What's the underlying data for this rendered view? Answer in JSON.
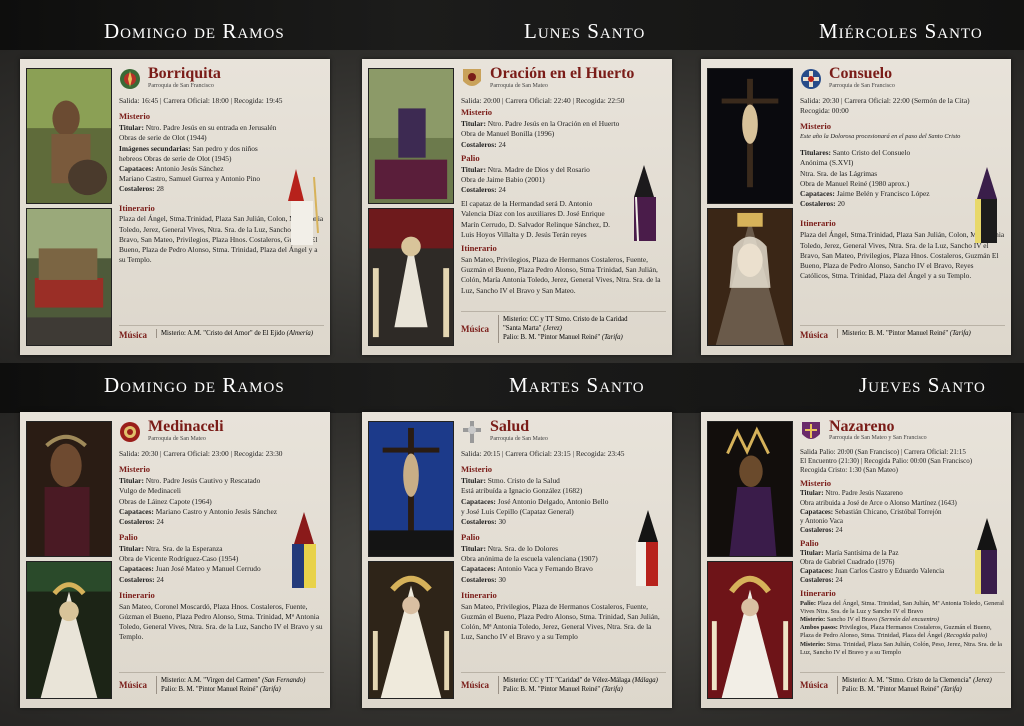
{
  "headers": {
    "h1": "Domingo de Ramos",
    "h2": "Lunes Santo",
    "h3": "Miércoles Santo",
    "h4": "Domingo de Ramos",
    "h5": "Martes Santo",
    "h6": "Jueves Santo"
  },
  "labels": {
    "misterio": "Misterio",
    "palio": "Palio",
    "itinerario": "Itinerario",
    "musica": "Música"
  },
  "c1": {
    "name": "Borriquita",
    "parish": "Parroquia de San Francisco",
    "schedule": "Salida: 16:45 | Carrera Oficial: 18:00 | Recogida: 19:45",
    "m1": "Ntro. Padre Jesús en su entrada en Jerusalén",
    "m2": "Obras de serie de Olot (1944)",
    "m3": "San pedro y dos niños",
    "m4": "hebreos Obras de serie de Olot (1945)",
    "m5": "Antonio Jesús Sánchez",
    "m6": "Mariano Castro, Samuel Gurrea y Antonio Pino",
    "m7": "28",
    "itin": "Plaza del Ángel, Stma.Trinidad, Plaza San Julián, Colon, Mª Antonia Toledo, Jerez, General Vives, Ntra. Sra. de la Luz, Sancho IV el Bravo, San Mateo, Privilegios, Plaza Hnos. Costaleros, Guzmán El Bueno, Plaza de Pedro Alonso, Stma. Trinidad, Plaza del Ángel y a su Templo.",
    "music": "Misterio: A.M. \"Cristo del Amor\" de El Ejido",
    "music_it": "(Almería)"
  },
  "c2": {
    "name": "Oración en el Huerto",
    "parish": "Parroquia de San Mateo",
    "schedule": "Salida: 20:00 | Carrera Oficial: 22:40 | Recogida: 22:50",
    "m1": "Ntro. Padre Jesús en la Oración en el Huerto",
    "m2": "Obra de Manuel Bonilla (1996)",
    "m3": "24",
    "p1": "Ntra. Madre de Dios y del Rosario",
    "p2": "Obra de Jaime Babio (2001)",
    "p3": "24",
    "capataz": "El capataz de la Hermandad será D. Antonio Valencia Díaz con los auxiliares D. José Enrique Marín Cerrudo, D. Salvador Relinque Sánchez, D. Luis Hoyos Villalta y D. Jesús Terán reyes",
    "itin": "San Mateo, Privilegios, Plaza de Hermanos Costaleros, Fuente, Guzmán el Bueno, Plaza Pedro Alonso, Stma Trinidad, San Julián, Colón, María Antonia Toledo, Jerez, General Vives, Ntra. Sra. de la Luz, Sancho IV el Bravo y San Mateo.",
    "music1": "Misterio: CC y TT Stmo. Cristo de la Caridad",
    "music2": "\"Santa Marta\"",
    "music2_it": "(Jerez)",
    "music3": "Palio: B. M. \"Pintor Manuel Reiné\"",
    "music3_it": "(Tarifa)"
  },
  "c3": {
    "name": "Consuelo",
    "parish": "Parroquia de San Francisco",
    "schedule": "Salida: 20:30 | Carrera Oficial: 22:00 (Sermón de la Cita)",
    "schedule2": "Recogida: 00:00",
    "note": "Este año la Dolorosa procesionará en el paso del Santo Cristo",
    "m1": "Santo Cristo del Consuelo",
    "m2": "Anónima (S.XVI)",
    "m3": "Ntra. Sra. de las Lágrimas",
    "m4": "Obra de Manuel Reiné (1980 aprox.)",
    "m5": "Jaime Belén y Francisco López",
    "m6": "20",
    "itin": "Plaza del Ángel, Stma.Trinidad, Plaza San Julián, Colon, Mª Antonia Toledo, Jerez, General Vives, Ntra. Sra. de la Luz, Sancho IV el Bravo, San Mateo, Privilegios, Plaza Hnos. Costaleros, Guzmán El Bueno, Plaza de Pedro Alonso, Sancho IV el Bravo, Reyes Católicos, Stma. Trinidad, Plaza del Ángel y a su Templo.",
    "music": "Misterio: B. M. \"Pintor Manuel Reiné\"",
    "music_it": "(Tarifa)"
  },
  "c4": {
    "name": "Medinaceli",
    "parish": "Parroquia de San Mateo",
    "schedule": "Salida: 20:30 | Carrera Oficial: 23:00 | Recogida: 23:30",
    "m1": "Ntro. Padre Jesús Cautivo y Rescatado",
    "m2": "Vulgo de Medinaceli",
    "m3": "Obras de Láinez Capote (1964)",
    "m4": "Mariano Castro y Antonio Jesús Sánchez",
    "m5": "24",
    "p1": "Ntra. Sra. de la Esperanza",
    "p2": "Obra de Vicente Rodríguez-Caso (1954)",
    "p3": "Juan José Mateo y Manuel Cerrudo",
    "p4": "24",
    "itin": "San Mateo, Coronel Moscardó, Plaza Hnos. Costaleros, Fuente, Gúzman el Bueno, Plaza Pedro Alonso, Stma. Trinidad, Mª Antonia Toledo, General Vives, Ntra. Sra. de la Luz, Sancho IV el Bravo y su Templo.",
    "music1": "Misterio: A.M. \"Virgen del Carmen\"",
    "music1_it": "(San Fernando)",
    "music2": "Palio: B. M. \"Pintor Manuel Reiné\"",
    "music2_it": "(Tarifa)"
  },
  "c5": {
    "name": "Salud",
    "parish": "Parroquia de San Mateo",
    "schedule": "Salida: 20:15 | Carrera Oficial: 23:15 | Recogida: 23:45",
    "m1": "Stmo. Cristo de la Salud",
    "m2": "Está atribuída a Ignacio González (1682)",
    "m3": "José Antonio Delgado, Antonio Bello",
    "m4": "y José Luis Cepillo (Capataz General)",
    "m5": "30",
    "p1": "Ntra. Sra. de lo Dolores",
    "p2": "Obra anónima de la escuela valenciana (1907)",
    "p3": "Antonio Vaca y Fernando Bravo",
    "p4": "30",
    "itin": "San Mateo, Privilegios, Plaza de Hermanos Costaleros, Fuente, Guzmán el Bueno, Plaza Pedro Alonso, Stma. Trinidad, San Julián, Colón, Mª Antonia Toledo, Jerez, General Vives, Ntra. Sra. de la Luz, Sancho IV el Bravo y a su Templo",
    "music1": "Misterio: CC y TT \"Caridad\" de Vélez-Málaga",
    "music1_it": "(Málaga)",
    "music2": "Palio: B. M. \"Pintor Manuel Reiné\"",
    "music2_it": "(Tarifa)"
  },
  "c6": {
    "name": "Nazareno",
    "parish": "Parroquia de San Mateo y San Francisco",
    "schedule1": "Salida Palio: 20:00 (San Francisco) | Carrera Oficial: 21:15",
    "schedule2": "El Encuentro (21:30) | Recogida Palio: 00:00 (San Francisco)",
    "schedule3": "Recogida Cristo: 1:30 (San Mateo)",
    "m1": "Ntro. Padre Jesús Nazareno",
    "m2": "Obra atribuida a José de Arce o Alonso Martínez (1643)",
    "m3": "Sebastián Chicano, Cristóbal Torrejón",
    "m4": "y Antonio Vaca",
    "m5": "24",
    "p1": "María Santísima de la Paz",
    "p2": "Obra de Gabriel Cuadrado (1976)",
    "p3": "Juan Carlos Castro y Eduardo Valencia",
    "p4": "24",
    "i1": "Plaza del Ángel, Stma. Trinidad, San Julián, Mª Antonia Toledo, General Vives Ntra. Sra. de la Luz y Sancho IV el Bravo",
    "i2": "Sancho IV el Bravo",
    "i2_it": "(Sermón del encuentro)",
    "i3": "Privilegios, Plaza Hermanos Costaleros, Guzmán el Bueno, Plaza de Pedro Alonso, Stma. Trinidad, Plaza del Ángel",
    "i3_it": "(Recogida palio)",
    "i4": "Stma. Trinidad, Plaza San Julián, Colón, Peso, Jerez, Ntra. Sra. de la Luz, Sancho IV el Bravo y a su Templo",
    "music1": "Misterio: A. M. \"Stmo. Cristo de la Clemencia\"",
    "music1_it": "(Jerez)",
    "music2": "Palio: B. M. \"Pintor Manuel Reiné\"",
    "music2_it": "(Tarifa)"
  },
  "keys": {
    "titular": "Titular:",
    "imagenes": "Imágenes secundarias:",
    "capataces": "Capataces:",
    "costaleros": "Costaleros:",
    "titulares": "Titulares:",
    "palio": "Palio:",
    "misterio": "Misterio:",
    "ambos": "Ambos pasos:"
  }
}
